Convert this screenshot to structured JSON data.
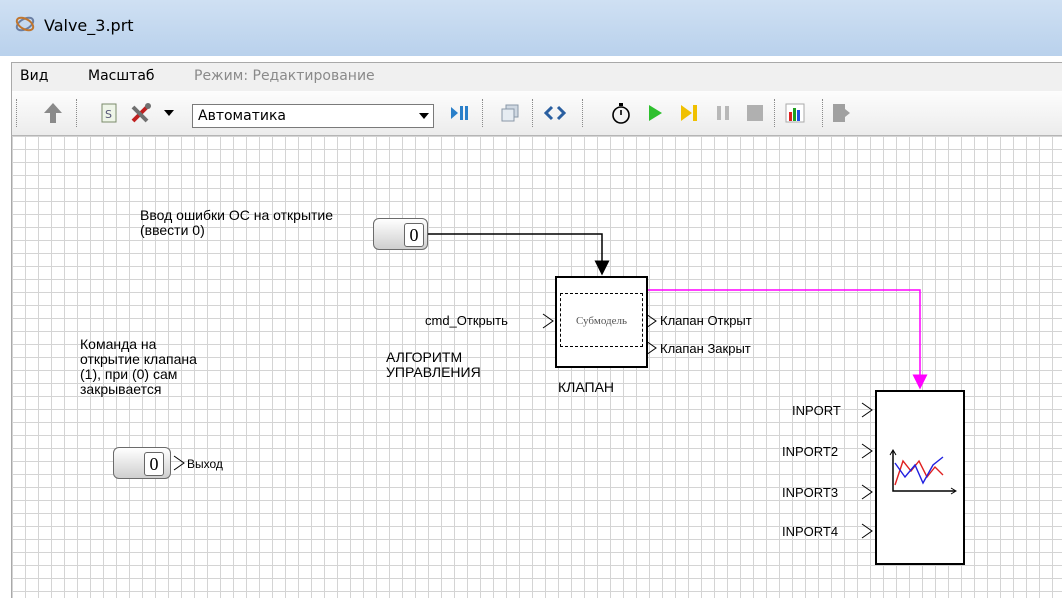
{
  "window": {
    "title": "Valve_3.prt"
  },
  "menu": {
    "view": "Вид",
    "scale": "Масштаб",
    "mode": "Режим: Редактирование"
  },
  "toolbar": {
    "library_select": "Автоматика"
  },
  "diagram": {
    "error_label": "Ввод ошибки ОС на открытие (ввести 0)",
    "error_const_value": "0",
    "command_label": "Команда на открытие клапана (1), при (0) сам закрывается",
    "command_const_value": "0",
    "command_output_port": "Выход",
    "valve_input_port": "cmd_Открыть",
    "valve_submodel_text": "Субмодель",
    "valve_out_open": "Клапан Открыт",
    "valve_out_closed": "Клапан Закрыт",
    "algorithm_label": "АЛГОРИТМ УПРАВЛЕНИЯ",
    "valve_name": "КЛАПАН",
    "plot_ports": [
      "INPORT",
      "INPORT2",
      "INPORT3",
      "INPORT4"
    ],
    "link_color_control": "#000000",
    "link_color_plot": "#ff00ff"
  }
}
